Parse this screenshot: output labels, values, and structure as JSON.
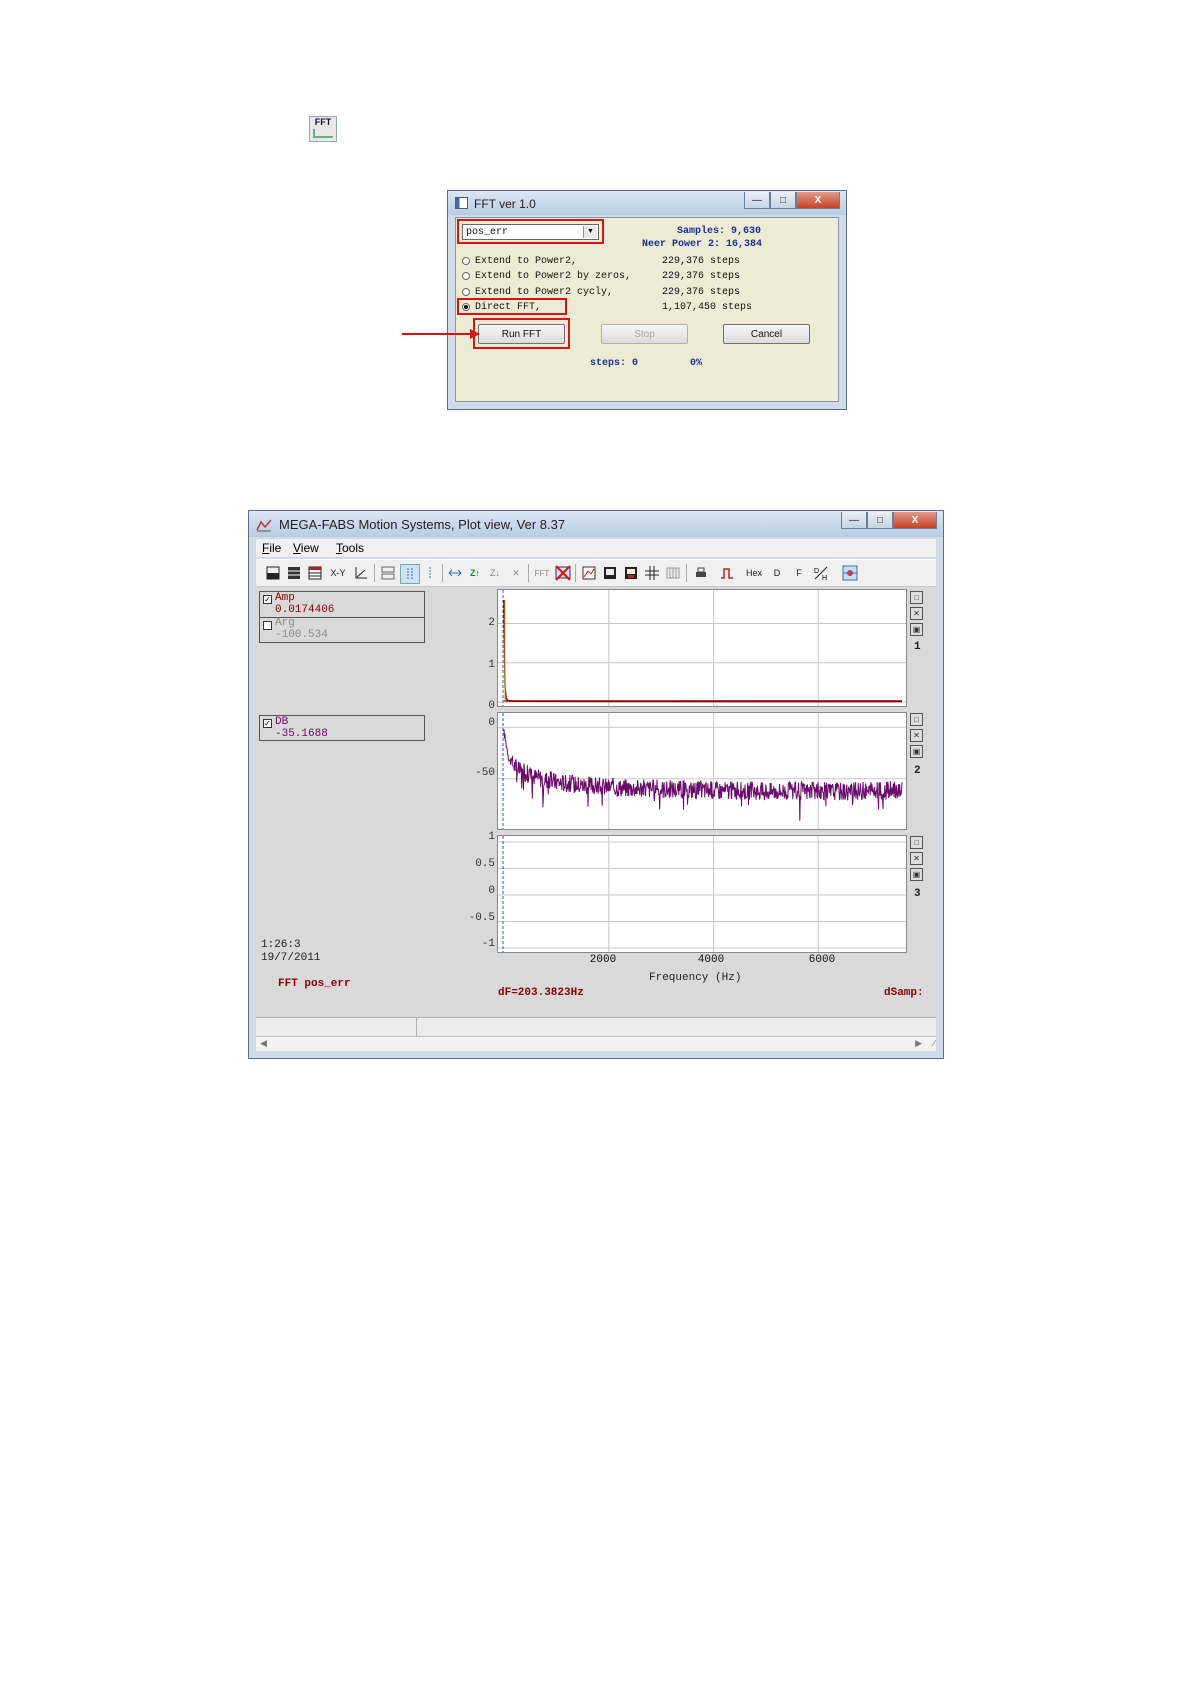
{
  "fft_tool_icon": {
    "label": "FFT",
    "icon": "fft-spectrum-icon"
  },
  "fft_dialog": {
    "title": "FFT ver 1.0",
    "signal_select": {
      "value": "pos_err"
    },
    "samples_label": "Samples: 9,630",
    "near_power_label": "Neer Power 2: 16,384",
    "options": [
      {
        "label": "Extend to Power2,",
        "steps": "229,376 steps",
        "selected": false
      },
      {
        "label": "Extend to Power2 by zeros,",
        "steps": "229,376 steps",
        "selected": false
      },
      {
        "label": "Extend to Power2 cycly,",
        "steps": "229,376 steps",
        "selected": false
      },
      {
        "label": "Direct FFT,",
        "steps": "1,107,450 steps",
        "selected": true
      }
    ],
    "buttons": {
      "run": "Run FFT",
      "stop": "Stop",
      "cancel": "Cancel"
    },
    "progress_steps": "steps: 0",
    "progress_percent": "0%"
  },
  "annotation": {
    "highlight_color": "#dd1111",
    "arrow_color": "#dd1111"
  },
  "plot_window": {
    "title": "MEGA-FABS Motion Systems, Plot view, Ver 8.37",
    "menu": [
      "File",
      "View",
      "Tools"
    ],
    "toolbar": {
      "xy_label": "X-Y",
      "hex_label": "Hex",
      "d_label": "D",
      "f_label": "F"
    },
    "legends": {
      "amp": {
        "name": "Amp",
        "value": "0.0174406",
        "checked": true,
        "color": "#8b0000"
      },
      "arg": {
        "name": "Arg",
        "value": "-100.534",
        "checked": false,
        "color": "#8a8a8a"
      },
      "db": {
        "name": "DB",
        "value": "-35.1688",
        "checked": true,
        "color": "#6a0a6a"
      }
    },
    "plot_numbers": [
      "1",
      "2",
      "3"
    ],
    "y_ticks": {
      "plot1": [
        "2",
        "1",
        "0"
      ],
      "plot2": [
        "0",
        "-50"
      ],
      "plot3": [
        "1",
        "0.5",
        "0",
        "-0.5",
        "-1"
      ]
    },
    "x_ticks": [
      "2000",
      "4000",
      "6000"
    ],
    "x_axis_label": "Frequency (Hz)",
    "time_label": "1:26:3",
    "date_label": "19/7/2011",
    "fft_caption": "FFT pos_err",
    "df_label": "dF=203.3823Hz",
    "dsamp_label": "dSamp:"
  },
  "chart_data": [
    {
      "type": "line",
      "series": [
        {
          "name": "Amp",
          "color": "#8b0000"
        }
      ],
      "xlim": [
        0,
        7600
      ],
      "ylim": [
        0,
        2.7
      ],
      "note_values": "spike near 0 Hz then ~0",
      "x": [
        0,
        20,
        40,
        80,
        200,
        1000,
        3000,
        5000,
        7600
      ],
      "y": [
        2.6,
        0.4,
        0.1,
        0.03,
        0.02,
        0.015,
        0.012,
        0.01,
        0.01
      ]
    },
    {
      "type": "line",
      "series": [
        {
          "name": "DB",
          "color": "#6a0a6a"
        }
      ],
      "xlim": [
        0,
        7600
      ],
      "ylim": [
        -95,
        8
      ],
      "x": [
        0,
        100,
        300,
        600,
        1000,
        1500,
        2000,
        3000,
        4000,
        5000,
        6000,
        7000,
        7600
      ],
      "y": [
        -5,
        -32,
        -42,
        -48,
        -53,
        -56,
        -58,
        -60,
        -61,
        -62,
        -62,
        -62,
        -61
      ]
    },
    {
      "type": "line",
      "xlim": [
        0,
        7600
      ],
      "ylim": [
        -1,
        1
      ],
      "x": [],
      "y": []
    }
  ]
}
